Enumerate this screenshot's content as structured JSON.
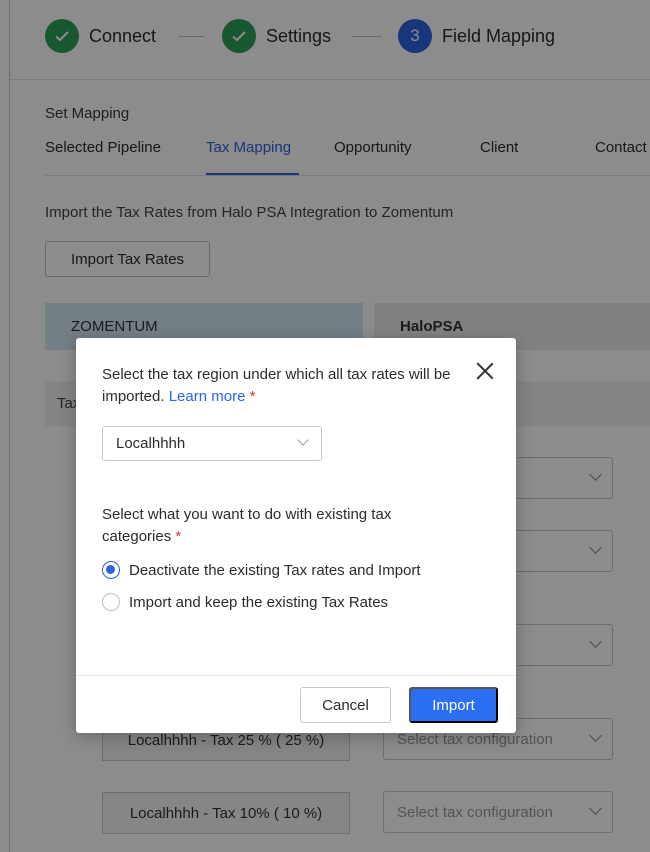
{
  "stepper": {
    "steps": [
      {
        "label": "Connect",
        "state": "done",
        "icon": "check-icon"
      },
      {
        "label": "Settings",
        "state": "done",
        "icon": "check-icon"
      },
      {
        "label": "Field Mapping",
        "state": "active",
        "number": "3"
      }
    ]
  },
  "content": {
    "section_title": "Set Mapping",
    "tabs": [
      "Selected Pipeline",
      "Tax Mapping",
      "Opportunity",
      "Client",
      "Contact"
    ],
    "active_tab": "Tax Mapping",
    "import_description": "Import the Tax Rates from Halo PSA Integration to Zomentum",
    "import_button": "Import Tax Rates",
    "columns": {
      "left": "ZOMENTUM",
      "right": "HaloPSA"
    },
    "sub_header": "Tax",
    "rows": [
      {
        "tax": "Localhhhh - Tax 25 % ( 25 %)",
        "select_placeholder": "Select tax configuration"
      },
      {
        "tax": "Localhhhh - Tax 10% ( 10 %)",
        "select_placeholder": "Select tax configuration"
      }
    ]
  },
  "modal": {
    "question_region": "Select the tax region under which all tax rates will be imported.",
    "learn_more": "Learn more",
    "required_mark": "*",
    "region_value": "Localhhhh",
    "question_action": "Select what you want to do with existing tax categories",
    "options": [
      {
        "label": "Deactivate the existing Tax rates and Import",
        "checked": true
      },
      {
        "label": "Import and keep the existing Tax Rates",
        "checked": false
      }
    ],
    "cancel_label": "Cancel",
    "import_label": "Import"
  },
  "colors": {
    "primary": "#2c6ef0",
    "success": "#2c9e57",
    "required": "#dd3333",
    "zomentum_header": "#d2e5f2"
  }
}
